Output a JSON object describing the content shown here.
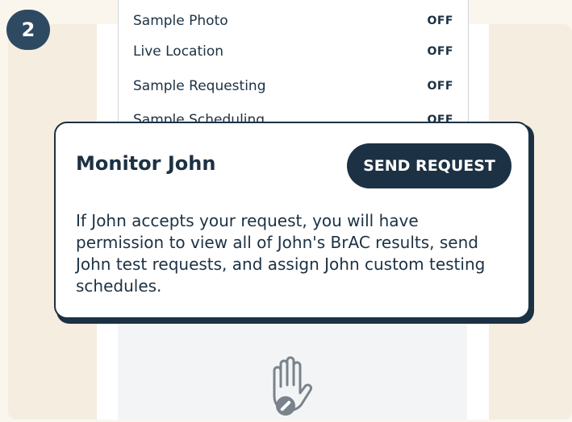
{
  "step": {
    "number": "2"
  },
  "settings": {
    "rows": [
      {
        "label": "Sample Photo",
        "value": "OFF"
      },
      {
        "label": "Live Location",
        "value": "OFF"
      },
      {
        "label": "Sample Requesting",
        "value": "OFF"
      },
      {
        "label": "Sample Scheduling",
        "value": "OFF"
      }
    ]
  },
  "card": {
    "title": "Monitor John",
    "send_label": "SEND REQUEST",
    "body": "If John accepts your request, you will have permission to view all of John's BrAC results, send John test requests, and assign John custom testing schedules."
  },
  "icons": {
    "empty_state": "hand-stop-icon"
  },
  "colors": {
    "navy": "#1c3143",
    "badge": "#2e4a63",
    "cream": "#f5ede0"
  }
}
